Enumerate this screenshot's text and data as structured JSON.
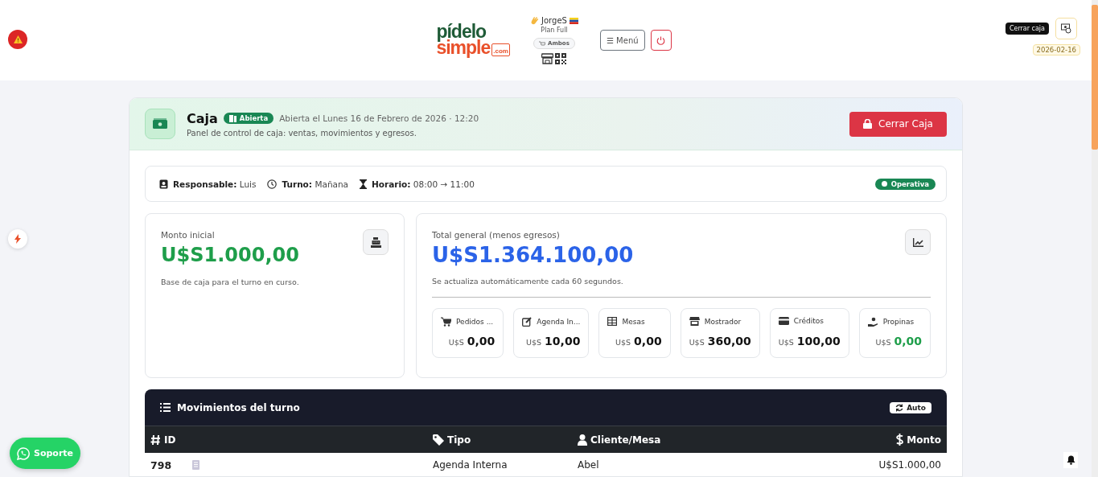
{
  "header": {
    "logo": {
      "line_1": "pídelo",
      "line_2": "simple",
      "suffix": ".com"
    },
    "user": {
      "name": "JorgeS",
      "plan": "Plan Full",
      "mode": "Ambos"
    },
    "menu_button": "☰ Menú",
    "close_tooltip": "Cerrar caja",
    "date": "2026-02-16"
  },
  "caja": {
    "title": "Caja",
    "status": "Abierta",
    "opened_text": "Abierta el Lunes 16 de Febrero de 2026 · 12:20",
    "subtitle": "Panel de control de caja: ventas, movimientos y egresos.",
    "close_button": "Cerrar Caja"
  },
  "info": {
    "items": [
      {
        "kind": "person",
        "label": "Responsable:",
        "value": "Luis"
      },
      {
        "kind": "clock",
        "label": "Turno:",
        "value": "Mañana"
      },
      {
        "kind": "hourglass",
        "label": "Horario:",
        "value": "08:00 → 11:00"
      }
    ],
    "status": "Operativa"
  },
  "initial": {
    "label": "Monto inicial",
    "amount": "U$S1.000,00",
    "note": "Base de caja para el turno en curso."
  },
  "total": {
    "label": "Total general (menos egresos)",
    "amount": "U$S1.364.100,00",
    "note": "Se actualiza automáticamente cada 60 segundos.",
    "breakdown": [
      {
        "kind": "cart",
        "label": "Pedidos ...",
        "currency": "U$S",
        "amount": "0,00"
      },
      {
        "kind": "edit",
        "label": "Agenda In...",
        "currency": "U$S",
        "amount": "10,00"
      },
      {
        "kind": "table",
        "label": "Mesas",
        "currency": "U$S",
        "amount": "0,00"
      },
      {
        "kind": "store",
        "label": "Mostrador",
        "currency": "U$S",
        "amount": "360,00"
      },
      {
        "kind": "card",
        "label": "Créditos",
        "currency": "U$S",
        "amount": "100,00"
      },
      {
        "kind": "tip",
        "label": "Propinas",
        "currency": "U$S",
        "amount": "0,00"
      }
    ]
  },
  "movements": {
    "title": "Movimientos del turno",
    "auto_button": "Auto",
    "columns": [
      {
        "kind": "hash",
        "label": "ID"
      },
      {
        "kind": "tag",
        "label": "Tipo"
      },
      {
        "kind": "user",
        "label": "Cliente/Mesa"
      },
      {
        "kind": "dollar",
        "label": "Monto"
      }
    ],
    "rows": [
      {
        "id": "798",
        "type": "Agenda Interna",
        "client": "Abel",
        "amount": "U$S1.000,00"
      }
    ]
  },
  "support_button": "Soporte"
}
